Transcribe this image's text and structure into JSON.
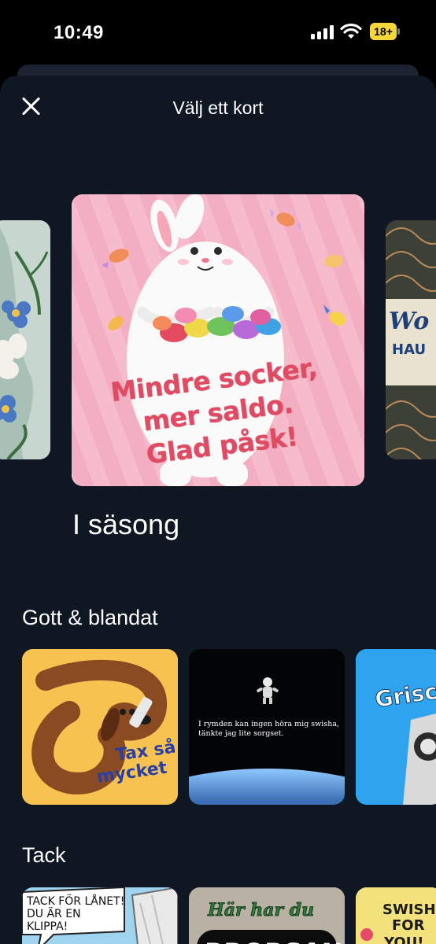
{
  "status_bar": {
    "time": "10:49",
    "battery": "18+"
  },
  "sheet": {
    "title": "Välj ett kort",
    "close_icon": "close-icon"
  },
  "carousel": {
    "selected_card": {
      "text_lines": [
        "Mindre socker,",
        "mer saldo.",
        "Glad påsk!"
      ],
      "background_color": "#f4b8c9",
      "accent_color": "#e04a63"
    },
    "right_peek_text": [
      "Wo",
      "HAU"
    ],
    "category_label": "I säsong"
  },
  "sections": [
    {
      "title": "Gott & blandat",
      "cards": [
        {
          "text": "Tax så mycket",
          "line1": "Tax så",
          "line2": "mycket",
          "bg": "#f7c24f"
        },
        {
          "text": "I rymden kan ingen höra mig swisha, tänkte jag lite sorgset.",
          "line1": "I rymden kan ingen höra mig swisha,",
          "line2": "tänkte jag lite sorgset.",
          "bg": "#000000"
        },
        {
          "text": "Grisc",
          "bg": "#2ea3ee"
        }
      ]
    },
    {
      "title": "Tack",
      "cards": [
        {
          "line1": "TACK FÖR LÅNET!",
          "line2": "DU ÄR EN",
          "line3": "KLIPPA!",
          "bg": "#9fd4ee"
        },
        {
          "line1": "Här har du",
          "line2": "BRORSAN",
          "bg": "#b9b2a4"
        },
        {
          "line1": "SWISH",
          "line2": "FOR",
          "line3": "YOU!",
          "bg": "#f3e27b"
        }
      ]
    }
  ],
  "colors": {
    "sheet_bg": "#0f1722",
    "screen_bg": "#000000"
  }
}
